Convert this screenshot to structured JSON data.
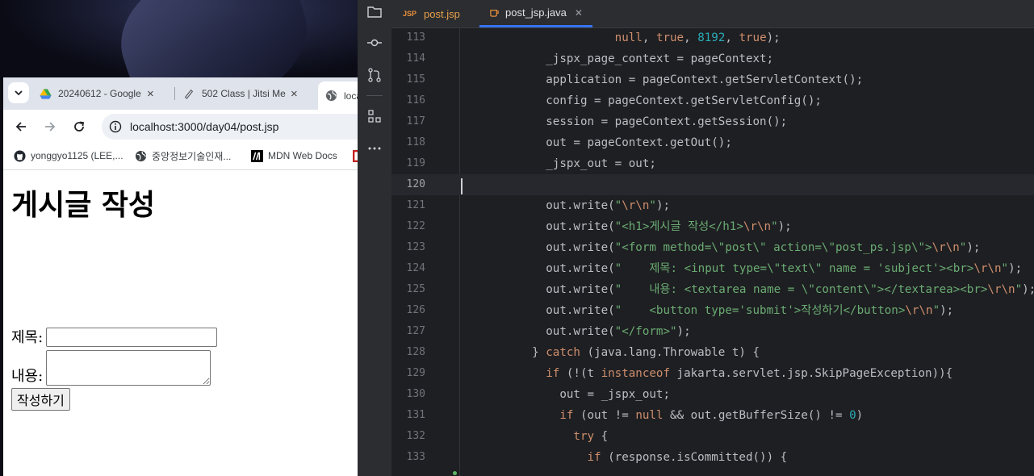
{
  "browser": {
    "tabs": [
      {
        "title": "20240612 - Google",
        "icon": "google-drive-icon"
      },
      {
        "title": "502 Class | Jitsi Me",
        "icon": "jitsi-icon"
      },
      {
        "title": "loca",
        "icon": "globe-icon"
      }
    ],
    "url": "localhost:3000/day04/post.jsp",
    "bookmarks": [
      {
        "label": "yonggyo1125 (LEE,...",
        "icon": "github-icon"
      },
      {
        "label": "중앙정보기술인재...",
        "icon": "globe-icon"
      },
      {
        "label": "MDN Web Docs",
        "icon": "mdn-icon"
      }
    ],
    "page": {
      "heading": "게시글 작성",
      "subject_label": "제목:",
      "content_label": "내용:",
      "submit_label": "작성하기"
    }
  },
  "ide": {
    "tabs": [
      {
        "label": "post.jsp",
        "icon_text": "JSP",
        "active": false
      },
      {
        "label": "post_jsp.java",
        "icon_text": "",
        "active": true
      }
    ],
    "current_line": 120,
    "code_lines": [
      {
        "no": "113",
        "code": "                null, true, 8192, true);"
      },
      {
        "no": "114",
        "code": "      _jspx_page_context = pageContext;"
      },
      {
        "no": "115",
        "code": "      application = pageContext.getServletContext();"
      },
      {
        "no": "116",
        "code": "      config = pageContext.getServletConfig();"
      },
      {
        "no": "117",
        "code": "      session = pageContext.getSession();"
      },
      {
        "no": "118",
        "code": "      out = pageContext.getOut();"
      },
      {
        "no": "119",
        "code": "      _jspx_out = out;"
      },
      {
        "no": "120",
        "code": ""
      },
      {
        "no": "121",
        "code": "      out.write(\"\\r\\n\");"
      },
      {
        "no": "122",
        "code": "      out.write(\"<h1>게시글 작성</h1>\\r\\n\");"
      },
      {
        "no": "123",
        "code": "      out.write(\"<form method=\\\"post\\\" action=\\\"post_ps.jsp\\\">\\r\\n\");"
      },
      {
        "no": "124",
        "code": "      out.write(\"    제목: <input type=\\\"text\\\" name = 'subject'><br>\\r\\n\");"
      },
      {
        "no": "125",
        "code": "      out.write(\"    내용: <textarea name = \\\"content\\\"></textarea><br>\\r\\n\");"
      },
      {
        "no": "126",
        "code": "      out.write(\"    <button type='submit'>작성하기</button>\\r\\n\");"
      },
      {
        "no": "127",
        "code": "      out.write(\"</form>\");"
      },
      {
        "no": "128",
        "code": "    } catch (java.lang.Throwable t) {"
      },
      {
        "no": "129",
        "code": "      if (!(t instanceof jakarta.servlet.jsp.SkipPageException)){"
      },
      {
        "no": "130",
        "code": "        out = _jspx_out;"
      },
      {
        "no": "131",
        "code": "        if (out != null && out.getBufferSize() != 0)"
      },
      {
        "no": "132",
        "code": "          try {"
      },
      {
        "no": "133",
        "code": "            if (response.isCommitted()) {"
      }
    ]
  },
  "colors": {
    "ide_bg": "#1e1f22",
    "keyword": "#cf8e6d",
    "string": "#6aab73",
    "number": "#2aacb8",
    "accent": "#3574f0"
  }
}
